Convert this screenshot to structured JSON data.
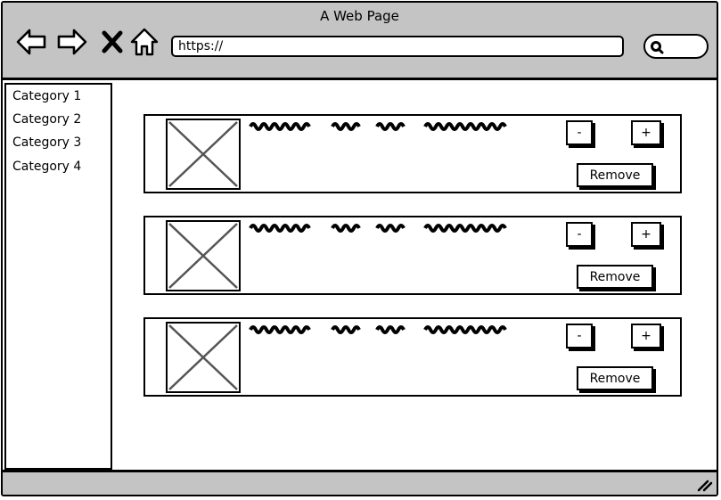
{
  "window": {
    "title": "A Web Page"
  },
  "toolbar": {
    "back_icon": "arrow-left-icon",
    "forward_icon": "arrow-right-icon",
    "stop_icon": "close-icon",
    "home_icon": "home-icon",
    "search_icon": "search-icon"
  },
  "address_bar": {
    "value": "https://"
  },
  "sidebar": {
    "items": [
      {
        "label": "Category 1"
      },
      {
        "label": "Category 2"
      },
      {
        "label": "Category 3"
      },
      {
        "label": "Category 4"
      }
    ]
  },
  "items": [
    {
      "decrement_label": "-",
      "increment_label": "+",
      "remove_label": "Remove"
    },
    {
      "decrement_label": "-",
      "increment_label": "+",
      "remove_label": "Remove"
    },
    {
      "decrement_label": "-",
      "increment_label": "+",
      "remove_label": "Remove"
    }
  ],
  "colors": {
    "chrome": "#c4c4c4",
    "border": "#000000",
    "background": "#ffffff",
    "placeholder_x": "#555555"
  }
}
